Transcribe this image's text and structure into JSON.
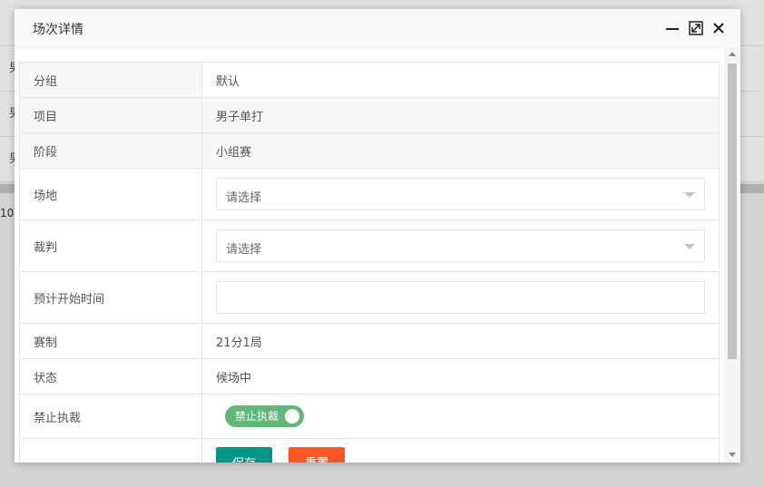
{
  "background": {
    "row_prefix": "男",
    "pager_text": "10"
  },
  "modal": {
    "title": "场次详情",
    "rows": [
      {
        "label": "分组",
        "value": "默认"
      },
      {
        "label": "项目",
        "value": "男子单打"
      },
      {
        "label": "阶段",
        "value": "小组赛"
      },
      {
        "label": "场地",
        "select_value": "请选择"
      },
      {
        "label": "裁判",
        "select_value": "请选择"
      },
      {
        "label": "预计开始时间",
        "input_value": ""
      },
      {
        "label": "赛制",
        "value": "21分1局"
      },
      {
        "label": "状态",
        "value": "候场中"
      },
      {
        "label": "禁止执裁",
        "switch_label": "禁止执裁",
        "switch_on": true
      }
    ],
    "buttons": {
      "save": "保存",
      "reset": "重置"
    }
  },
  "colors": {
    "status": "#ff5722",
    "switch_on": "#5fb878",
    "save_button": "#009688",
    "reset_button": "#ff5722"
  },
  "icons": [
    "minimize-icon",
    "maximize-icon",
    "close-icon",
    "chevron-down-icon"
  ]
}
